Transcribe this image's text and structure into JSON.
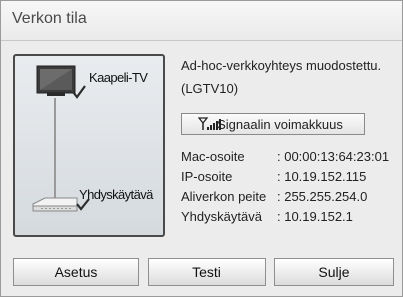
{
  "dialog": {
    "title": "Verkon tila",
    "network": {
      "top_node_label": "Kaapeli-TV",
      "bottom_node_label": "Yhdyskäytävä",
      "top_node_icon": "tv-icon",
      "bottom_node_icon": "router-icon",
      "top_link_status_icon": "checkmark-icon",
      "bottom_link_status_icon": "checkmark-icon"
    },
    "message_line1": "Ad-hoc-verkkoyhteys muodostettu.",
    "message_line2": "(LGTV10)",
    "signal_button_label": "Signaalin voimakkuus",
    "signal_icon": "signal-strength-icon",
    "info": [
      {
        "key": "Mac-osoite",
        "value": ": 00:00:13:64:23:01"
      },
      {
        "key": "IP-osoite",
        "value": ": 10.19.152.115"
      },
      {
        "key": "Aliverkon peite",
        "value": ": 255.255.254.0"
      },
      {
        "key": "Yhdyskäytävä",
        "value": ": 10.19.152.1"
      }
    ],
    "buttons": {
      "setup": "Asetus",
      "test": "Testi",
      "close": "Sulje"
    }
  }
}
